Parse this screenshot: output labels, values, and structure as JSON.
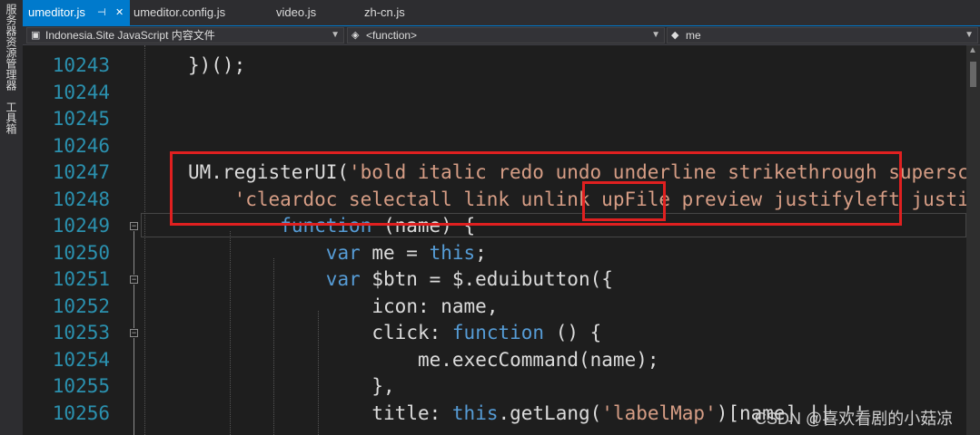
{
  "sidebar": {
    "items": [
      "服务器资源管理器",
      "工具箱"
    ]
  },
  "tabs": [
    {
      "label": "umeditor.js",
      "active": true
    },
    {
      "label": "umeditor.config.js",
      "active": false
    },
    {
      "label": "video.js",
      "active": false
    },
    {
      "label": "zh-cn.js",
      "active": false
    }
  ],
  "tab_icons": {
    "pin": "pin-icon",
    "close": "close-icon"
  },
  "navbar": {
    "project": "Indonesia.Site JavaScript 内容文件",
    "scope": "<function>",
    "member": "me"
  },
  "code": {
    "lines": [
      {
        "num": "10243",
        "segments": [
          {
            "t": "})();",
            "c": "pl"
          }
        ]
      },
      {
        "num": "10244",
        "segments": []
      },
      {
        "num": "10245",
        "segments": []
      },
      {
        "num": "10246",
        "segments": []
      },
      {
        "num": "10247",
        "segments": [
          {
            "t": "UM.registerUI(",
            "c": "pl"
          },
          {
            "t": "'bold italic redo undo underline strikethrough superscri",
            "c": "str"
          }
        ]
      },
      {
        "num": "10248",
        "segments": [
          {
            "t": "'cleardoc selectall link unlink upFile preview justifyleft justify",
            "c": "str"
          }
        ]
      },
      {
        "num": "10249",
        "segments": [
          {
            "t": "function",
            "c": "kw"
          },
          {
            "t": " (name) {",
            "c": "pl"
          }
        ]
      },
      {
        "num": "10250",
        "segments": [
          {
            "t": "var",
            "c": "kw"
          },
          {
            "t": " me = ",
            "c": "pl"
          },
          {
            "t": "this",
            "c": "kw"
          },
          {
            "t": ";",
            "c": "pl"
          }
        ]
      },
      {
        "num": "10251",
        "segments": [
          {
            "t": "var",
            "c": "kw"
          },
          {
            "t": " $btn = $.eduibutton({",
            "c": "pl"
          }
        ]
      },
      {
        "num": "10252",
        "segments": [
          {
            "t": "icon: name,",
            "c": "pl"
          }
        ]
      },
      {
        "num": "10253",
        "segments": [
          {
            "t": "click: ",
            "c": "pl"
          },
          {
            "t": "function",
            "c": "kw"
          },
          {
            "t": " () {",
            "c": "pl"
          }
        ]
      },
      {
        "num": "10254",
        "segments": [
          {
            "t": "me.execCommand(name);",
            "c": "pl"
          }
        ]
      },
      {
        "num": "10255",
        "segments": [
          {
            "t": "},",
            "c": "pl"
          }
        ]
      },
      {
        "num": "10256",
        "segments": [
          {
            "t": "title: ",
            "c": "pl"
          },
          {
            "t": "this",
            "c": "kw"
          },
          {
            "t": ".getLang(",
            "c": "pl"
          },
          {
            "t": "'labelMap'",
            "c": "str"
          },
          {
            "t": ")[name] || ''",
            "c": "pl"
          }
        ]
      }
    ]
  },
  "watermark": "CSDN @喜欢看剧的小菇凉",
  "colors": {
    "accent": "#007acc",
    "string": "#d69d85",
    "keyword": "#569cd6",
    "line_number": "#2b91af",
    "annotation": "#e02020"
  }
}
